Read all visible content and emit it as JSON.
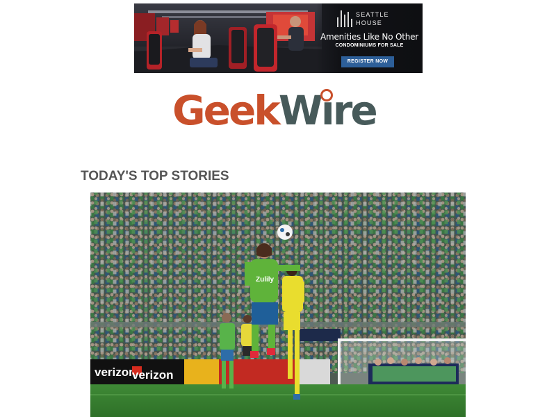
{
  "ad": {
    "brand_name": "SEATTLE\nHOUSE",
    "tagline": "Amenities Like No Other",
    "subtagline": "CONDOMINIUMS FOR SALE",
    "cta_label": "REGISTER NOW",
    "cta_color": "#2d5f99"
  },
  "logo": {
    "part1": "Geek",
    "part2a": "W",
    "part2b": "i",
    "part2c": "re",
    "colors": {
      "geek": "#c9502b",
      "wire": "#475a5a"
    }
  },
  "section": {
    "title": "TODAY'S TOP STORIES"
  },
  "story": {
    "photo_sponsor_text": [
      "verizon",
      "verizon"
    ],
    "jersey_sponsor": "Zulily"
  }
}
